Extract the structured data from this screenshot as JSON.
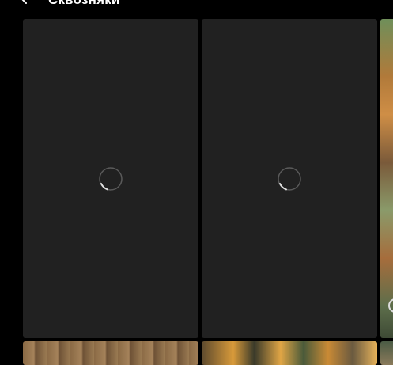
{
  "header": {
    "title": "Сквозняки",
    "back_icon": "arrow-left-icon"
  },
  "gallery": {
    "tiles": [
      {
        "state": "loading",
        "icon": "loading-spinner-icon"
      },
      {
        "state": "loading",
        "icon": "loading-spinner-icon"
      },
      {
        "state": "loaded",
        "content": "photo"
      },
      {
        "state": "loaded",
        "content": "photo"
      },
      {
        "state": "loaded",
        "content": "photo"
      },
      {
        "state": "loaded",
        "content": "photo"
      }
    ]
  },
  "colors": {
    "background": "#000000",
    "tile_placeholder": "#212121",
    "text": "#ffffff",
    "spinner": "#8a8a8a"
  }
}
